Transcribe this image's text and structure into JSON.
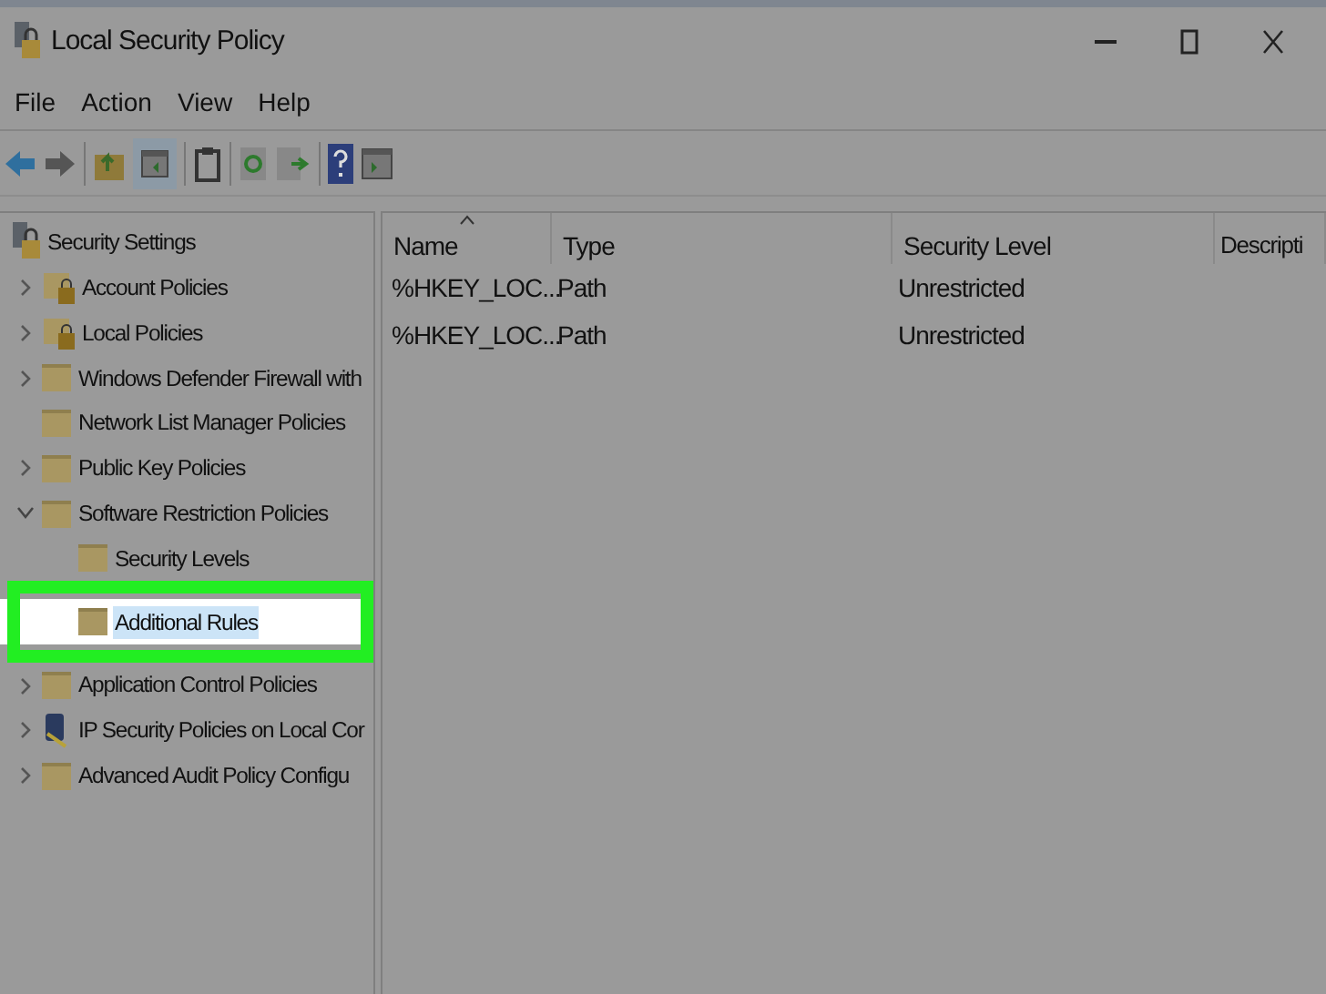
{
  "window": {
    "title": "Local Security Policy"
  },
  "menu": [
    "File",
    "Action",
    "View",
    "Help"
  ],
  "tree": [
    {
      "label": "Security Settings",
      "kind": "root",
      "children": [
        {
          "label": "Account Policies",
          "kind": "locked-folder",
          "expanded": false
        },
        {
          "label": "Local Policies",
          "kind": "locked-folder",
          "expanded": false
        },
        {
          "label": "Windows Defender Firewall with",
          "kind": "folder",
          "expanded": false
        },
        {
          "label": "Network List Manager Policies",
          "kind": "folder"
        },
        {
          "label": "Public Key Policies",
          "kind": "folder",
          "expanded": false
        },
        {
          "label": "Software Restriction Policies",
          "kind": "folder",
          "expanded": true,
          "children": [
            {
              "label": "Security Levels",
              "kind": "folder",
              "selected": false
            },
            {
              "label": "Additional Rules",
              "kind": "folder",
              "selected": true
            }
          ]
        },
        {
          "label": "Application Control Policies",
          "kind": "folder",
          "expanded": false
        },
        {
          "label": "IP Security Policies on Local Cor",
          "kind": "network",
          "expanded": false
        },
        {
          "label": "Advanced Audit Policy Configu",
          "kind": "folder",
          "expanded": false
        }
      ]
    }
  ],
  "table": {
    "columns": [
      "Name",
      "Type",
      "Security Level",
      "Descripti"
    ],
    "rows": [
      [
        "%HKEY_LOC...",
        "Path",
        "Unrestricted"
      ],
      [
        "%HKEY_LOC...",
        "Path",
        "Unrestricted"
      ]
    ]
  }
}
